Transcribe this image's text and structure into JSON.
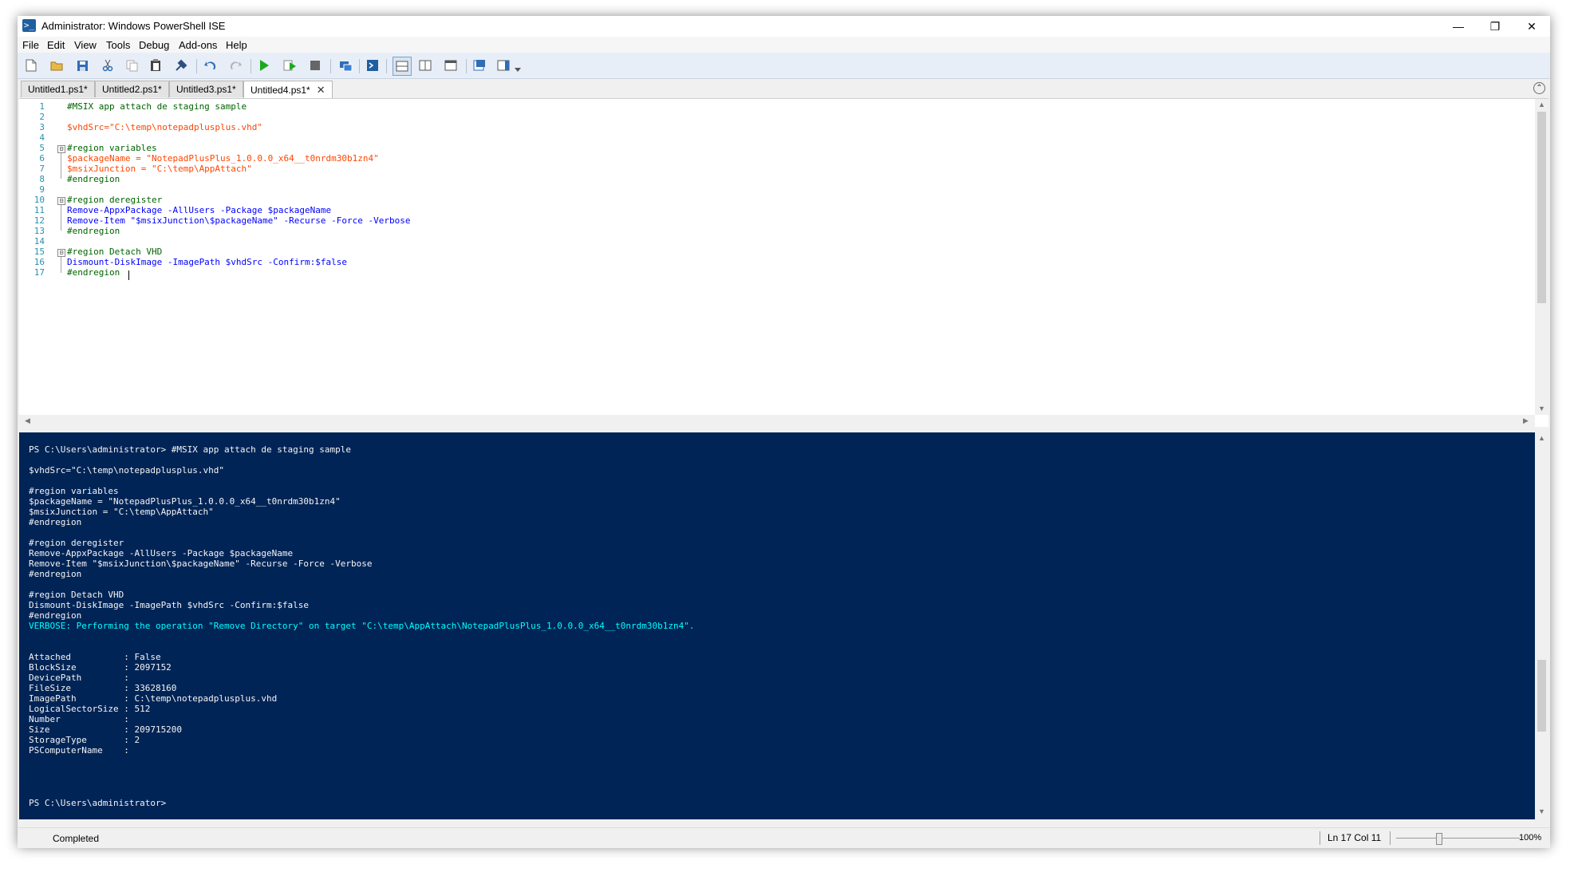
{
  "window": {
    "title": "Administrator: Windows PowerShell ISE",
    "controls": {
      "minimize": "—",
      "maximize": "❐",
      "close": "✕"
    }
  },
  "menu": [
    "File",
    "Edit",
    "View",
    "Tools",
    "Debug",
    "Add-ons",
    "Help"
  ],
  "toolbar": {
    "buttons": [
      "new-icon",
      "open-icon",
      "save-icon",
      "cut-icon",
      "copy-icon",
      "paste-icon",
      "clear-console-icon",
      "undo-icon",
      "redo-icon",
      "run-icon",
      "run-selection-icon",
      "stop-icon",
      "remote-powershell-icon",
      "start-powershell-icon",
      "show-script-pane-top-icon",
      "show-script-pane-right-icon",
      "show-script-pane-maximized-icon",
      "show-command-window-icon",
      "show-command-addon-icon"
    ]
  },
  "tabs": [
    {
      "label": "Untitled1.ps1*",
      "active": false
    },
    {
      "label": "Untitled2.ps1*",
      "active": false
    },
    {
      "label": "Untitled3.ps1*",
      "active": false
    },
    {
      "label": "Untitled4.ps1*",
      "active": true
    }
  ],
  "editor": {
    "line_numbers": [
      "1",
      "2",
      "3",
      "4",
      "5",
      "6",
      "7",
      "8",
      "9",
      "10",
      "11",
      "12",
      "13",
      "14",
      "15",
      "16",
      "17"
    ],
    "lines": [
      "#MSIX app attach de staging sample",
      "",
      "$vhdSrc=\"C:\\temp\\notepadplusplus.vhd\"",
      "",
      "#region variables",
      "$packageName = \"NotepadPlusPlus_1.0.0.0_x64__t0nrdm30b1zn4\"",
      "$msixJunction = \"C:\\temp\\AppAttach\"",
      "#endregion",
      "",
      "#region deregister",
      "Remove-AppxPackage -AllUsers -Package $packageName",
      "Remove-Item \"$msixJunction\\$packageName\" -Recurse -Force -Verbose",
      "#endregion",
      "",
      "#region Detach VHD",
      "Dismount-DiskImage -ImagePath $vhdSrc -Confirm:$false",
      "#endregion"
    ],
    "fold_markers": [
      "⊟",
      "⊟",
      "⊟"
    ]
  },
  "console": {
    "lines": [
      "PS C:\\Users\\administrator> #MSIX app attach de staging sample",
      "",
      "$vhdSrc=\"C:\\temp\\notepadplusplus.vhd\"",
      "",
      "#region variables",
      "$packageName = \"NotepadPlusPlus_1.0.0.0_x64__t0nrdm30b1zn4\"",
      "$msixJunction = \"C:\\temp\\AppAttach\"",
      "#endregion",
      "",
      "#region deregister",
      "Remove-AppxPackage -AllUsers -Package $packageName",
      "Remove-Item \"$msixJunction\\$packageName\" -Recurse -Force -Verbose",
      "#endregion",
      "",
      "#region Detach VHD",
      "Dismount-DiskImage -ImagePath $vhdSrc -Confirm:$false",
      "#endregion",
      "VERBOSE: Performing the operation \"Remove Directory\" on target \"C:\\temp\\AppAttach\\NotepadPlusPlus_1.0.0.0_x64__t0nrdm30b1zn4\".",
      "",
      "",
      "Attached          : False",
      "BlockSize         : 2097152",
      "DevicePath        :",
      "FileSize          : 33628160",
      "ImagePath         : C:\\temp\\notepadplusplus.vhd",
      "LogicalSectorSize : 512",
      "Number            :",
      "Size              : 209715200",
      "StorageType       : 2",
      "PSComputerName    :",
      "",
      "",
      "",
      "",
      "PS C:\\Users\\administrator>"
    ]
  },
  "status": {
    "text": "Completed",
    "position": "Ln 17  Col 11",
    "zoom": "100%"
  },
  "colors": {
    "console_bg": "#012456",
    "verbose": "#00ffff",
    "comment": "#006400",
    "variable": "#ff4500",
    "string": "#8b0000",
    "command": "#0000ff",
    "line_number": "#2b91af"
  }
}
